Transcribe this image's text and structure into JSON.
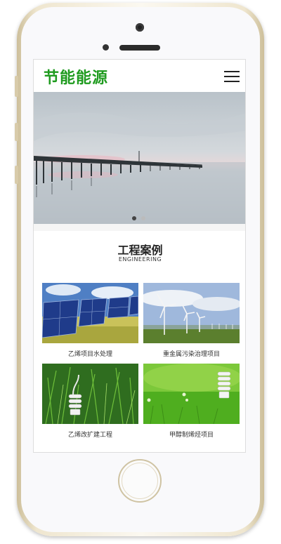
{
  "header": {
    "logo_text": "节能能源",
    "logo_color": "#1f9b1f",
    "menu_icon": "hamburger-menu-icon"
  },
  "banner": {
    "slide_count": 2,
    "active_slide": 1
  },
  "section": {
    "title": "工程案例",
    "subtitle": "ENGINEERING"
  },
  "cases": [
    {
      "caption": "乙烯项目水处理",
      "image": "solar-panels-field"
    },
    {
      "caption": "重金属污染治理项目",
      "image": "wind-turbines"
    },
    {
      "caption": "乙烯改扩建工程",
      "image": "bulb-in-grass"
    },
    {
      "caption": "甲醇制烯烃项目",
      "image": "bulb-on-lawn"
    }
  ]
}
